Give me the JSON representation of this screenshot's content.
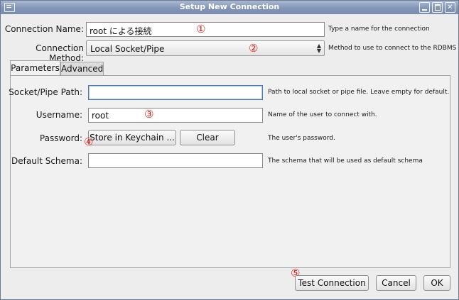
{
  "window": {
    "title": "Setup New Connection"
  },
  "form": {
    "connection_name": {
      "label": "Connection Name:",
      "value": "root による接続",
      "hint": "Type a name for the connection"
    },
    "connection_method": {
      "label": "Connection Method:",
      "value": "Local Socket/Pipe",
      "hint": "Method to use to connect to the RDBMS"
    }
  },
  "tabs": [
    {
      "label": "Parameters",
      "active": true
    },
    {
      "label": "Advanced",
      "active": false
    }
  ],
  "parameters": {
    "socket_path": {
      "label": "Socket/Pipe Path:",
      "value": "",
      "hint": "Path to local socket or pipe file. Leave empty for default."
    },
    "username": {
      "label": "Username:",
      "value": "root",
      "hint": "Name of the user to connect with."
    },
    "password": {
      "label": "Password:",
      "store_button": "Store in Keychain ...",
      "clear_button": "Clear",
      "hint": "The user's password."
    },
    "default_schema": {
      "label": "Default Schema:",
      "value": "",
      "hint": "The schema that will be used as default schema"
    }
  },
  "buttons": {
    "test_connection": "Test Connection",
    "cancel": "Cancel",
    "ok": "OK"
  },
  "annotations": [
    "①",
    "②",
    "③",
    "④",
    "⑤"
  ],
  "colors": {
    "titlebar": "#8395b6",
    "annotation": "#e0201a",
    "focus": "#4d7ab3"
  }
}
